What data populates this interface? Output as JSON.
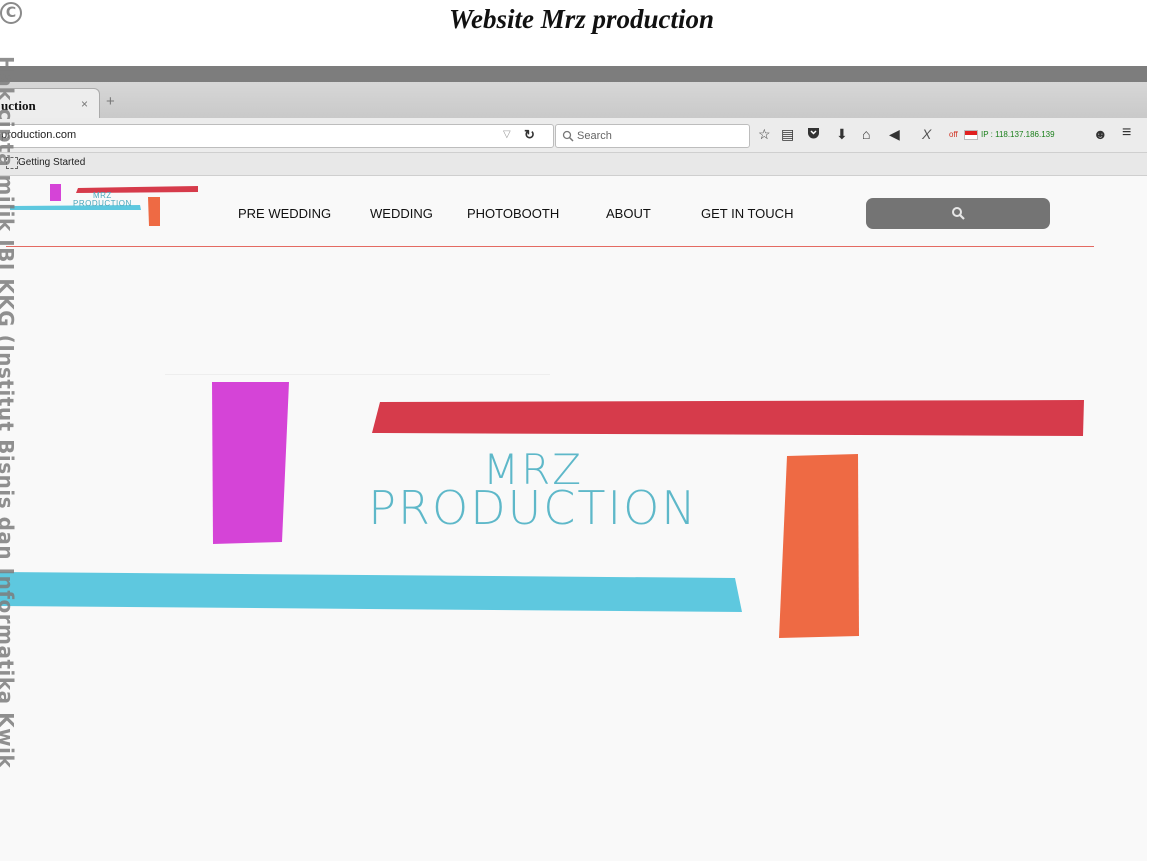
{
  "doc_caption": "Website Mrz production",
  "watermark": {
    "copyright_symbol": "C",
    "side_text": "Hak cipta milik IBI KKG (Institut Bisnis dan Informatika Kwik"
  },
  "browser": {
    "tab": {
      "title": "uction",
      "close": "×"
    },
    "new_tab": "+",
    "url": "production.com",
    "search_placeholder": "Search",
    "addon": {
      "status": "off",
      "ip": "IP : 118.137.186.139",
      "flag_colors": [
        "#e02020",
        "#ffffff"
      ]
    },
    "bookmarks": [
      {
        "label": "Getting Started"
      }
    ],
    "toolbar_icons": [
      "star-icon",
      "reading-list-icon",
      "pocket-icon",
      "download-icon",
      "home-icon",
      "send-icon",
      "x-icon",
      "smiley-icon",
      "menu-icon"
    ]
  },
  "site": {
    "nav": [
      "PRE WEDDING",
      "WEDDING",
      "PHOTOBOOTH",
      "ABOUT",
      "GET IN TOUCH"
    ],
    "logo_small": {
      "line1": "MRZ",
      "line2": "PRODUCTION"
    },
    "hero": {
      "line1": "MRZ",
      "line2": "PRODUCTION"
    },
    "brand_colors": {
      "magenta": "#d544d7",
      "red": "#d63b4b",
      "orange": "#ee6a44",
      "cyan": "#5ec8df",
      "text_teal": "#5eb8c9"
    }
  }
}
